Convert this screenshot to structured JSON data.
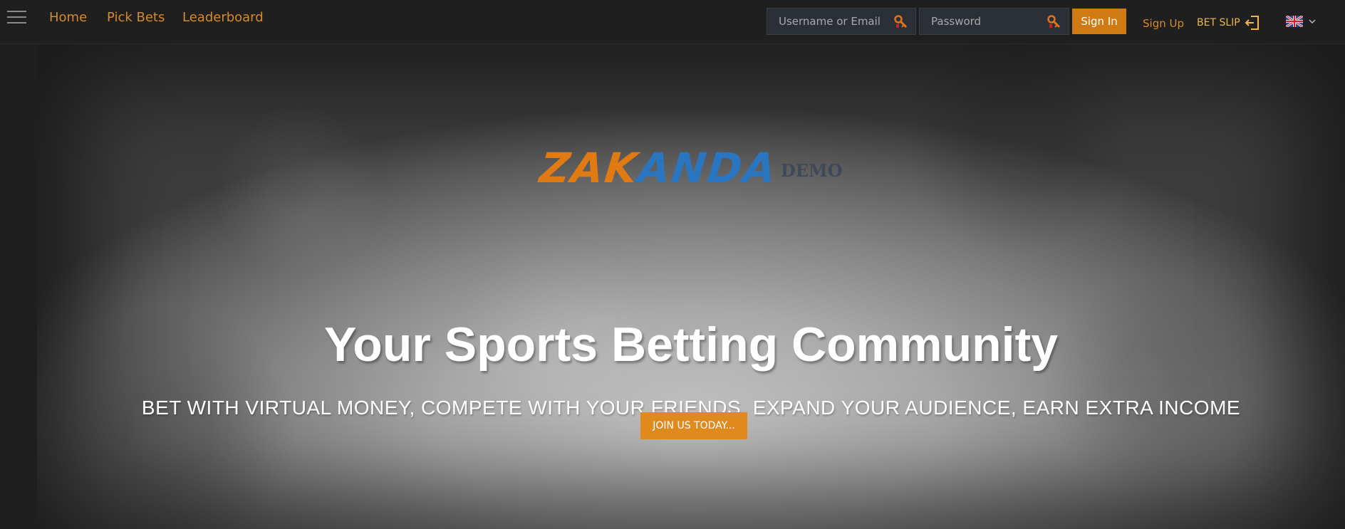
{
  "nav": {
    "links": [
      "Home",
      "Pick Bets",
      "Leaderboard"
    ]
  },
  "login": {
    "username_placeholder": "Username or Email",
    "password_placeholder": "Password",
    "signin_label": "Sign In",
    "signup_label": "Sign Up",
    "betslip_label": "BET SLIP",
    "language": "EN"
  },
  "hero": {
    "logo_part1": "ZAK",
    "logo_part2": "ANDA",
    "logo_demo": "DEMO",
    "headline": "Your Sports Betting Community",
    "tagline": "BET WITH VIRTUAL MONEY, COMPETE WITH YOUR FRIENDS, EXPAND YOUR AUDIENCE, EARN EXTRA INCOME",
    "cta_label": "JOIN US TODAY..."
  },
  "colors": {
    "accent": "#d48a2e",
    "signin_bg": "#d07a14",
    "cta_bg": "#e08a1e",
    "logo_orange": "#e07a12",
    "logo_blue": "#2a75c0"
  },
  "icons": {
    "menu": "hamburger-icon",
    "username_key": "key-icon",
    "password_key": "key-icon",
    "betslip": "sign-in-icon",
    "language": "uk-flag-icon",
    "language_dropdown": "chevron-down-icon"
  }
}
